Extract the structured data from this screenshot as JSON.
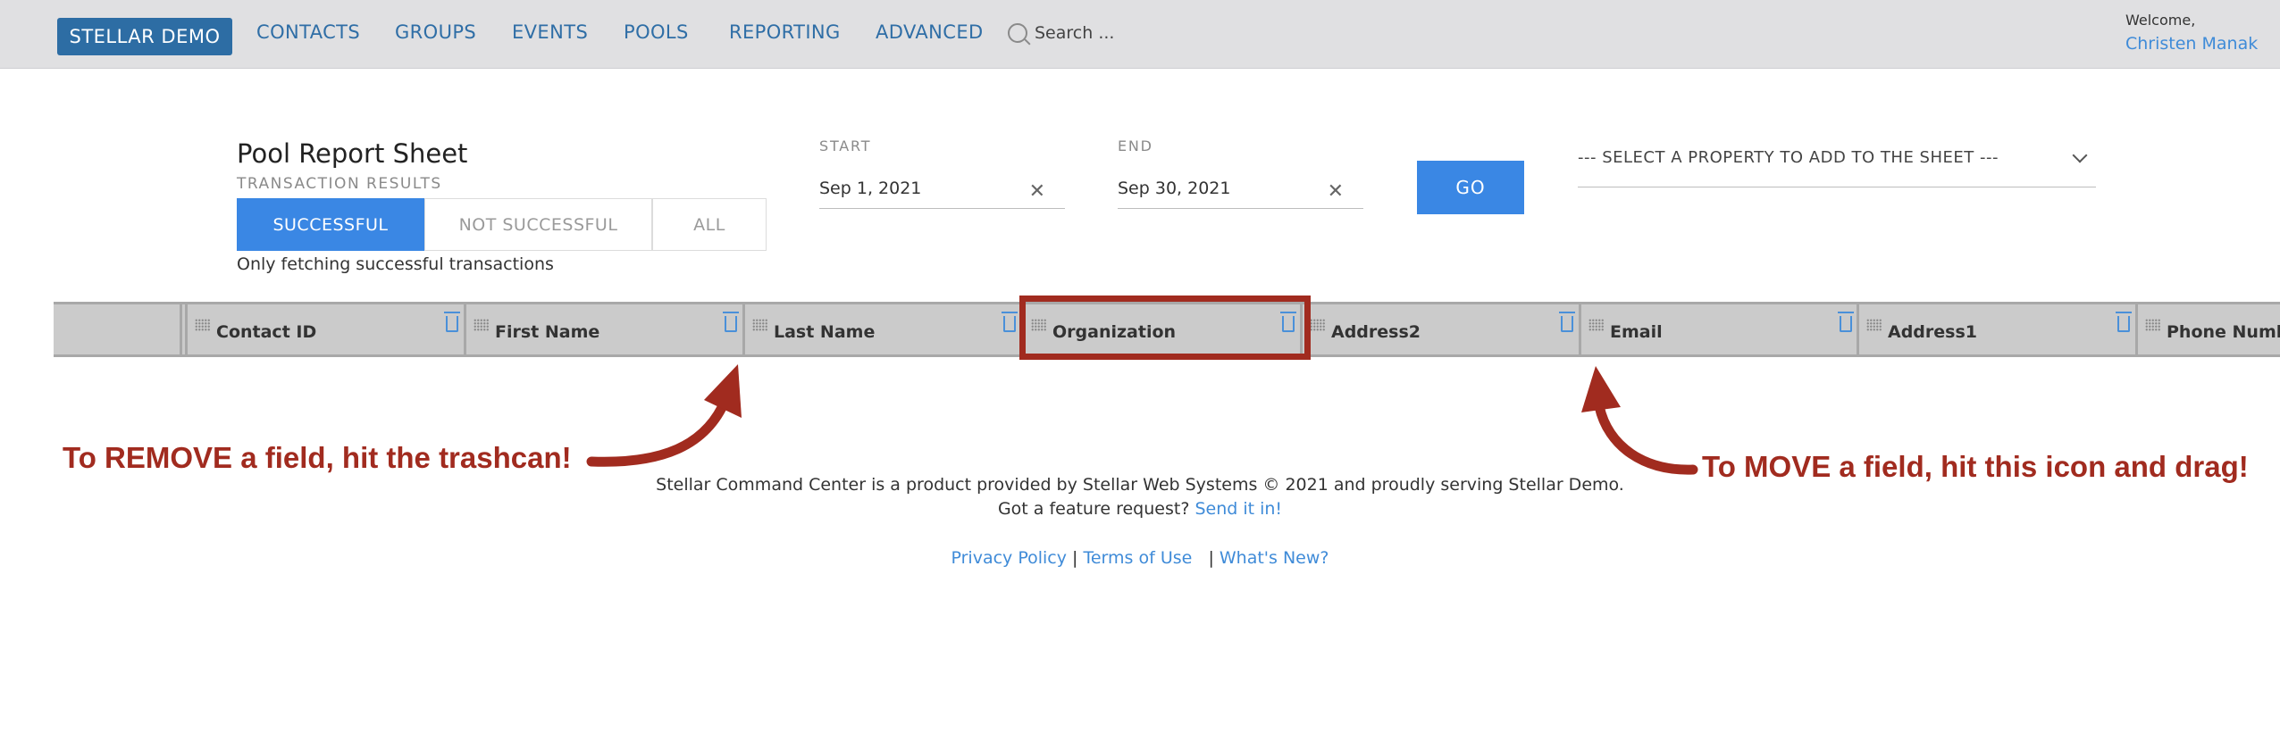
{
  "nav": {
    "brand": "STELLAR DEMO",
    "items": [
      "CONTACTS",
      "GROUPS",
      "EVENTS",
      "POOLS",
      "REPORTING",
      "ADVANCED"
    ],
    "search_placeholder": "Search ...",
    "welcome": "Welcome,",
    "user": "Christen Manak"
  },
  "report": {
    "title": "Pool Report Sheet",
    "subtitle": "TRANSACTION RESULTS",
    "toggles": [
      "SUCCESSFUL",
      "NOT SUCCESSFUL",
      "ALL"
    ],
    "active_toggle": "SUCCESSFUL",
    "helper": "Only fetching successful transactions",
    "start_label": "START",
    "start_value": "Sep 1, 2021",
    "end_label": "END",
    "end_value": "Sep 30, 2021",
    "go_label": "GO",
    "property_select": "--- SELECT A PROPERTY TO ADD TO THE SHEET ---"
  },
  "table": {
    "columns": [
      "Contact ID",
      "First Name",
      "Last Name",
      "Organization",
      "Address2",
      "Email",
      "Address1",
      "Phone Number"
    ]
  },
  "annotations": {
    "remove": "To REMOVE a field, hit the trashcan!",
    "move": "To MOVE a field, hit this icon and drag!"
  },
  "footer": {
    "line1": "Stellar Command Center is a product provided by Stellar Web Systems © 2021 and proudly serving Stellar Demo.",
    "line2_text": "Got a feature request?",
    "line2_link": "Send it in!",
    "links": [
      "Privacy Policy",
      "Terms of Use",
      "What's New?"
    ]
  },
  "colors": {
    "primary": "#3a87e4",
    "brand": "#2d6da4",
    "annotation": "#a12b1f"
  }
}
